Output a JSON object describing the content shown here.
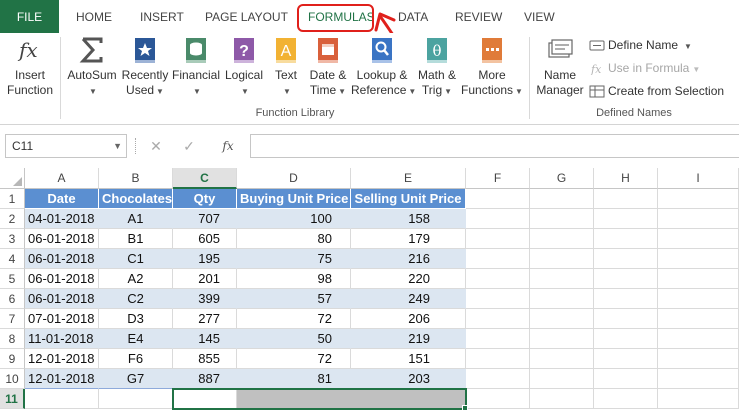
{
  "tabs": [
    {
      "id": "file",
      "label": "FILE"
    },
    {
      "id": "home",
      "label": "HOME"
    },
    {
      "id": "insert",
      "label": "INSERT"
    },
    {
      "id": "page_layout",
      "label": "PAGE LAYOUT"
    },
    {
      "id": "formulas",
      "label": "FORMULAS",
      "active": true
    },
    {
      "id": "data",
      "label": "DATA"
    },
    {
      "id": "review",
      "label": "REVIEW"
    },
    {
      "id": "view",
      "label": "VIEW"
    }
  ],
  "ribbon": {
    "insert_function": {
      "line1": "Insert",
      "line2": "Function",
      "icon": "fx-icon"
    },
    "function_library": {
      "label": "Function Library",
      "buttons": [
        {
          "line1": "AutoSum",
          "line2": "",
          "icon": "sigma-icon"
        },
        {
          "line1": "Recently",
          "line2": "Used",
          "icon": "star-book-icon"
        },
        {
          "line1": "Financial",
          "line2": "",
          "icon": "coins-book-icon"
        },
        {
          "line1": "Logical",
          "line2": "",
          "icon": "question-book-icon"
        },
        {
          "line1": "Text",
          "line2": "",
          "icon": "text-book-icon"
        },
        {
          "line1": "Date &",
          "line2": "Time",
          "icon": "calendar-book-icon"
        },
        {
          "line1": "Lookup &",
          "line2": "Reference",
          "icon": "magnifier-book-icon"
        },
        {
          "line1": "Math &",
          "line2": "Trig",
          "icon": "theta-book-icon"
        },
        {
          "line1": "More",
          "line2": "Functions",
          "icon": "more-book-icon"
        }
      ]
    },
    "defined_names": {
      "label": "Defined Names",
      "name_manager": {
        "line1": "Name",
        "line2": "Manager",
        "icon": "name-manager-icon"
      },
      "define_name": "Define Name",
      "use_in_formula": "Use in Formula",
      "create_from_selection": "Create from Selection"
    }
  },
  "formula_bar": {
    "name_box": "C11",
    "cancel_symbol": "✕",
    "enter_symbol": "✓",
    "fx_symbol": "fx",
    "formula": ""
  },
  "columns": [
    "A",
    "B",
    "C",
    "D",
    "E",
    "F",
    "G",
    "H",
    "I"
  ],
  "rows": [
    "1",
    "2",
    "3",
    "4",
    "5",
    "6",
    "7",
    "8",
    "9",
    "10",
    "11"
  ],
  "table": {
    "headers": [
      "Date",
      "Chocolates",
      "Qty",
      "Buying Unit Price",
      "Selling Unit Price"
    ],
    "data": [
      [
        "04-01-2018",
        "A1",
        "707",
        "100",
        "158"
      ],
      [
        "06-01-2018",
        "B1",
        "605",
        "80",
        "179"
      ],
      [
        "06-01-2018",
        "C1",
        "195",
        "75",
        "216"
      ],
      [
        "06-01-2018",
        "A2",
        "201",
        "98",
        "220"
      ],
      [
        "06-01-2018",
        "C2",
        "399",
        "57",
        "249"
      ],
      [
        "07-01-2018",
        "D3",
        "277",
        "72",
        "206"
      ],
      [
        "11-01-2018",
        "E4",
        "145",
        "50",
        "219"
      ],
      [
        "12-01-2018",
        "F6",
        "855",
        "72",
        "151"
      ],
      [
        "12-01-2018",
        "G7",
        "887",
        "81",
        "203"
      ]
    ]
  },
  "selected_cell": "C11",
  "colors": {
    "accent": "#217346",
    "table_header": "#5b8fd1",
    "band": "#dce6f1",
    "annotation": "#e0201b"
  }
}
